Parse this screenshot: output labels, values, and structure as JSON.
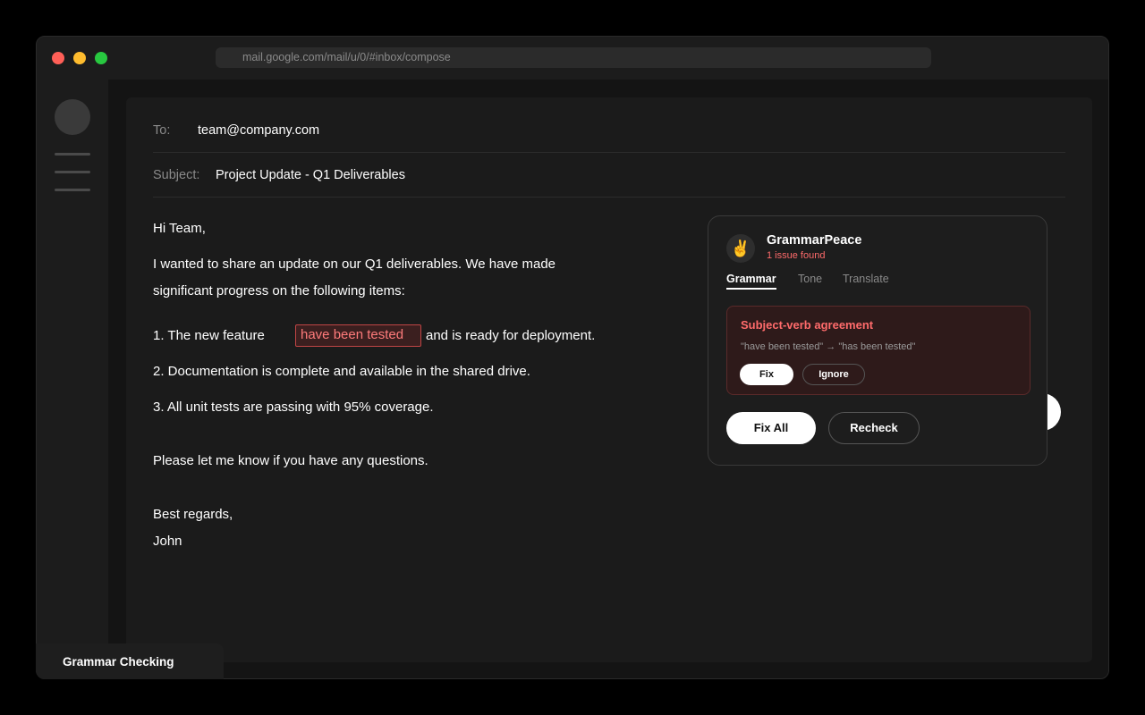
{
  "browser": {
    "url": "mail.google.com/mail/u/0/#inbox/compose"
  },
  "compose": {
    "to_label": "To:",
    "to_value": "team@company.com",
    "subject_label": "Subject:",
    "subject_value": "Project Update - Q1 Deliverables",
    "greeting": "Hi Team,",
    "intro_line1": "I wanted to share an update on our Q1 deliverables. We have made",
    "intro_line2": "significant progress on the following items:",
    "item1_before": "1. The new feature",
    "item1_error": "have been tested",
    "item1_after": "and is ready for deployment.",
    "item2": "2. Documentation is complete and available in the shared drive.",
    "item3": "3. All unit tests are passing with 95% coverage.",
    "closing": "Please let me know if you have any questions.",
    "signoff": "Best regards,",
    "signature": "John"
  },
  "panel": {
    "logo_glyph": "✌️",
    "app_name": "GrammarPeace",
    "issue_count": "1 issue found",
    "tabs": [
      {
        "label": "Grammar",
        "active": true
      },
      {
        "label": "Tone",
        "active": false
      },
      {
        "label": "Translate",
        "active": false
      }
    ],
    "issue": {
      "title": "Subject-verb agreement",
      "detail": "\"have been tested\" → \"has been tested\"",
      "fix_label": "Fix",
      "ignore_label": "Ignore"
    },
    "fix_all_label": "Fix All",
    "recheck_label": "Recheck"
  },
  "caption": "Grammar Checking",
  "colors": {
    "error": "#ff6b6b",
    "error_border": "#c04545",
    "panel_bg": "#1d1d1d",
    "page_bg": "#1b1b1b"
  }
}
